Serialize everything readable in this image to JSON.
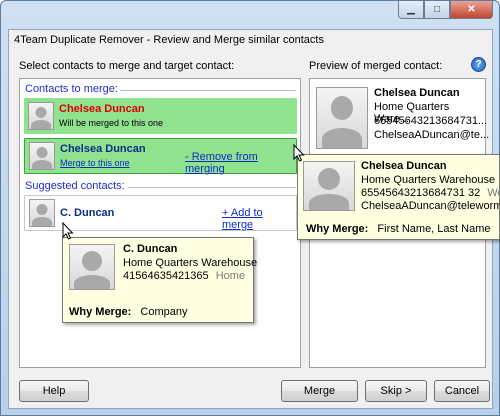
{
  "window": {
    "title": "4Team Duplicate Remover - Review and Merge similar contacts"
  },
  "left": {
    "heading": "Select contacts to merge and target contact:",
    "merge_group_label": "Contacts to merge:",
    "suggested_group_label": "Suggested contacts:",
    "contacts_to_merge": [
      {
        "name": "Chelsea Duncan",
        "subtitle": "Will be merged to this one"
      },
      {
        "name": "Chelsea Duncan",
        "link": "Merge to this one",
        "action": "- Remove from merging"
      }
    ],
    "suggested": [
      {
        "name": "C. Duncan",
        "action": "+ Add to merge"
      }
    ]
  },
  "right": {
    "heading": "Preview of merged contact:",
    "name": "Chelsea Duncan",
    "company": "Home Quarters Ware...",
    "phone": "65545643213684731...",
    "email": "ChelseaADuncan@te..."
  },
  "tooltip_main": {
    "name": "Chelsea Duncan",
    "company": "Home Quarters Warehouse",
    "phone": "65545643213684731 32",
    "phone_type": "Work",
    "email": "ChelseaADuncan@teleworm.us",
    "why_label": "Why Merge:",
    "why_value": "First Name, Last Name"
  },
  "tooltip_suggested": {
    "name": "C. Duncan",
    "company": "Home Quarters Warehouse",
    "phone": "41564635421365",
    "phone_type": "Home",
    "why_label": "Why Merge:",
    "why_value": "Company"
  },
  "buttons": {
    "help": "Help",
    "merge": "Merge",
    "skip": "Skip >",
    "cancel": "Cancel"
  },
  "icons": {
    "help": "?",
    "minimize": "▁",
    "maximize": "□",
    "close": "✕"
  }
}
